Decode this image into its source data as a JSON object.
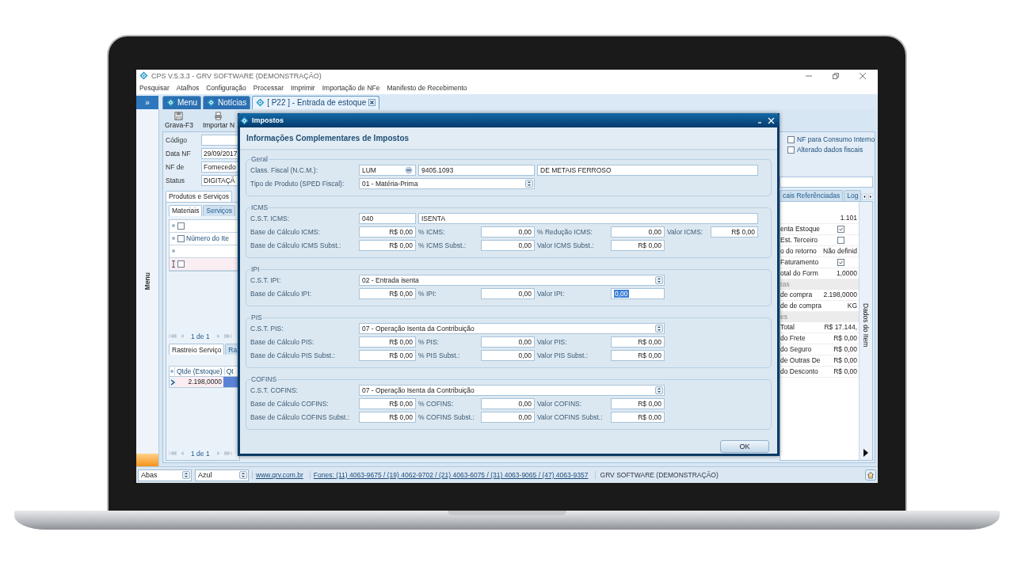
{
  "window": {
    "title": "CPS V.5.3.3 - GRV SOFTWARE (DEMONSTRAÇÃO)"
  },
  "menu": [
    "Pesquisar",
    "Atalhos",
    "Configuração",
    "Processar",
    "Imprimir",
    "Importação de NFe",
    "Manifesto de Recebimento"
  ],
  "sidebar": {
    "toggle": "»",
    "label": "Menu"
  },
  "tabs": [
    {
      "label": "Menu",
      "selected": false,
      "closable": false
    },
    {
      "label": "Notícias",
      "selected": false,
      "closable": false
    },
    {
      "label": "[ P22 ] - Entrada de estoque",
      "selected": true,
      "closable": true
    }
  ],
  "toolbar": [
    {
      "label": "Grava-F3"
    },
    {
      "label": "Importar N"
    }
  ],
  "form": {
    "fields": [
      {
        "label": "Código"
      },
      {
        "label": "Data NF",
        "value": "29/09/2017"
      },
      {
        "label": "NF de",
        "value": "Fornecedo"
      },
      {
        "label": "Status",
        "value": "DIGITAÇÃ"
      }
    ],
    "options": [
      {
        "label": "NF para Consumo Interno",
        "checked": false
      },
      {
        "label": "Alterado dados fiscais",
        "checked": false
      }
    ]
  },
  "left_panel": {
    "tabs": [
      {
        "label": "Produtos e Serviços",
        "selected": true
      }
    ],
    "subtabs": [
      {
        "label": "Materiais",
        "selected": true
      },
      {
        "label": "Serviços",
        "selected": false
      }
    ],
    "grid_rows": [
      {
        "kind": "header",
        "checked": false
      },
      {
        "kind": "header",
        "checked": false,
        "label": "Número do Ite"
      },
      {
        "kind": "blank"
      },
      {
        "kind": "new",
        "checked": false
      }
    ],
    "pager": "1 de 1"
  },
  "bottom_panel": {
    "tabs": [
      {
        "label": "Rastreio Serviço",
        "selected": true
      },
      {
        "label": "Ra",
        "selected": false
      }
    ],
    "columns": [
      "Qtde (Estoque)",
      "Qt"
    ],
    "rows": [
      [
        "2.198,0000"
      ]
    ],
    "pager": "1 de 1"
  },
  "right_panel": {
    "tabs": [
      {
        "label": "cais Referênciadas",
        "selected": false
      },
      {
        "label": "Log",
        "selected": false
      }
    ],
    "properties": [
      {
        "kind": "value",
        "value": "1.101"
      },
      {
        "kind": "check",
        "label": "enta Estoque",
        "checked": true
      },
      {
        "kind": "check",
        "label": "Est. Terceiro",
        "checked": false
      },
      {
        "kind": "value",
        "label": "o do retorno",
        "value": "Não definid"
      },
      {
        "kind": "check",
        "label": "Faturamento",
        "checked": true
      },
      {
        "kind": "value",
        "label": "otal do Form",
        "value": "1,0000"
      },
      {
        "kind": "category",
        "label": "ras"
      },
      {
        "kind": "value",
        "label": "de compra",
        "value": "2.198,0000"
      },
      {
        "kind": "value",
        "label": "de de compra",
        "value": "KG"
      },
      {
        "kind": "category",
        "label": "es"
      },
      {
        "kind": "value",
        "label": "Total",
        "value": "R$ 17.144,"
      },
      {
        "kind": "value",
        "label": "do Frete",
        "value": "R$ 0,00"
      },
      {
        "kind": "value",
        "label": "do Seguro",
        "value": "R$ 0,00"
      },
      {
        "kind": "value",
        "label": "de Outras De",
        "value": "R$ 0,00"
      },
      {
        "kind": "value",
        "label": "do Desconto",
        "value": "R$ 0,00"
      }
    ],
    "strip_label": "Dados do Item"
  },
  "status_bar": {
    "combos": [
      "Abas",
      "Azul"
    ],
    "links": [
      "www.grv.com.br",
      "Fones: (11) 4063-9675 / (19) 4062-9702 / (21) 4063-6075 / (31) 4063-9065 / (47) 4063-9357"
    ],
    "text": "GRV SOFTWARE (DEMONSTRAÇÃO)"
  },
  "dialog": {
    "title": "Impostos",
    "heading": "Informações Complementares de Impostos",
    "button": "OK",
    "groups": [
      {
        "title": "Geral",
        "rows": [
          {
            "kind": "lookup",
            "label": "Class. Fiscal (N.C.M.):",
            "values": [
              "LUM",
              "9405.1093",
              "DE METAIS FERROSO"
            ]
          },
          {
            "kind": "combo",
            "label": "Tipo de Produto (SPED Fiscal):",
            "value": "01 - Matéria-Prima"
          }
        ]
      },
      {
        "title": "ICMS",
        "rows": [
          {
            "kind": "code",
            "label": "C.S.T. ICMS:",
            "values": [
              "040",
              "ISENTA"
            ]
          },
          {
            "kind": "amounts",
            "cells": [
              {
                "label": "Base de Cálculo ICMS:",
                "value": "R$ 0,00",
                "highlighted": false
              },
              {
                "label": "% ICMS:",
                "value": "0,00",
                "highlighted": false
              },
              {
                "label": "% Redução ICMS:",
                "value": "0,00",
                "highlighted": false
              },
              {
                "label": "Valor ICMS:",
                "value": "R$ 0,00",
                "highlighted": false
              }
            ]
          },
          {
            "kind": "amounts",
            "cells": [
              {
                "label": "Base de Cálculo ICMS Subst.:",
                "value": "R$ 0,00",
                "highlighted": false
              },
              {
                "label": "% ICMS Subst.:",
                "value": "0,00",
                "highlighted": false
              },
              {
                "label": "Valor ICMS Subst.:",
                "value": "R$ 0,00",
                "highlighted": false
              }
            ]
          }
        ]
      },
      {
        "title": "IPI",
        "rows": [
          {
            "kind": "select",
            "label": "C.S.T. IPI:",
            "value": "02 - Entrada isenta"
          },
          {
            "kind": "amounts",
            "cells": [
              {
                "label": "Base de Cálculo IPI:",
                "value": "R$ 0,00",
                "highlighted": false
              },
              {
                "label": "% IPI:",
                "value": "0,00",
                "highlighted": false
              },
              {
                "label": "Valor IPI:",
                "value": "0,00",
                "highlighted": true
              }
            ]
          }
        ]
      },
      {
        "title": "PIS",
        "rows": [
          {
            "kind": "select",
            "label": "C.S.T. PIS:",
            "value": "07 - Operação Isenta da Contribuição"
          },
          {
            "kind": "amounts",
            "cells": [
              {
                "label": "Base de Cálculo PIS:",
                "value": "R$ 0,00",
                "highlighted": false
              },
              {
                "label": "% PIS:",
                "value": "0,00",
                "highlighted": false
              },
              {
                "label": "Valor PIS:",
                "value": "R$ 0,00",
                "highlighted": false
              }
            ]
          },
          {
            "kind": "amounts",
            "cells": [
              {
                "label": "Base de Cálculo PIS Subst.:",
                "value": "R$ 0,00",
                "highlighted": false
              },
              {
                "label": "% PIS Subst.:",
                "value": "0,00",
                "highlighted": false
              },
              {
                "label": "Valor PIS Subst.:",
                "value": "R$ 0,00",
                "highlighted": false
              }
            ]
          }
        ]
      },
      {
        "title": "COFINS",
        "rows": [
          {
            "kind": "select",
            "label": "C.S.T. COFINS:",
            "value": "07 - Operação Isenta da Contribuição"
          },
          {
            "kind": "amounts",
            "cells": [
              {
                "label": "Base de Cálculo COFINS:",
                "value": "R$ 0,00",
                "highlighted": false
              },
              {
                "label": "% COFINS:",
                "value": "0,00",
                "highlighted": false
              },
              {
                "label": "Valor COFINS:",
                "value": "R$ 0,00",
                "highlighted": false
              }
            ]
          },
          {
            "kind": "amounts",
            "cells": [
              {
                "label": "Base de Cálculo COFINS Subst.:",
                "value": "R$ 0,00",
                "highlighted": false
              },
              {
                "label": "% COFINS Subst.:",
                "value": "0,00",
                "highlighted": false
              },
              {
                "label": "Valor COFINS Subst.:",
                "value": "R$ 0,00",
                "highlighted": false
              }
            ]
          }
        ]
      }
    ]
  }
}
